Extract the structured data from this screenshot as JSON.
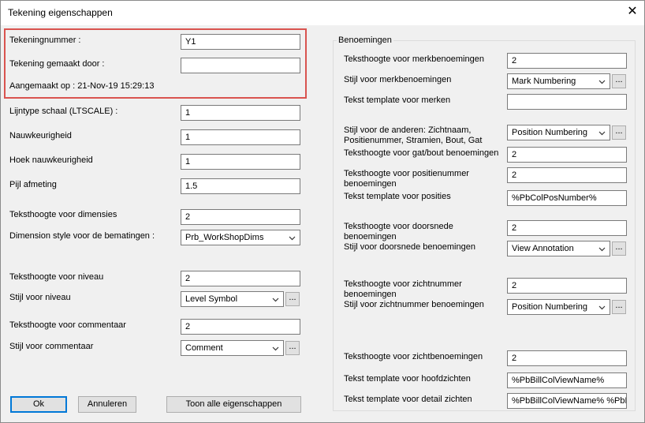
{
  "window": {
    "title": "Tekening eigenschappen",
    "close_glyph": "✕"
  },
  "left": {
    "drawing_number": {
      "label": "Tekeningnummer :",
      "value": "Y1"
    },
    "drawn_by": {
      "label": "Tekening gemaakt door :",
      "value": ""
    },
    "created": {
      "label": "Aangemaakt op :  21-Nov-19   15:29:13"
    },
    "ltscale": {
      "label": "Lijntype schaal (LTSCALE) :",
      "value": "1"
    },
    "precision": {
      "label": "Nauwkeurigheid",
      "value": "1"
    },
    "angle_precision": {
      "label": "Hoek nauwkeurigheid",
      "value": "1"
    },
    "arrow_size": {
      "label": "Pijl afmeting",
      "value": "1.5"
    },
    "dim_text_height": {
      "label": "Teksthoogte voor dimensies",
      "value": "2"
    },
    "dim_style": {
      "label": "Dimension style voor de bematingen :",
      "value": "Prb_WorkShopDims"
    },
    "level_text_height": {
      "label": "Teksthoogte voor niveau",
      "value": "2"
    },
    "level_style": {
      "label": "Stijl voor niveau",
      "value": "Level Symbol"
    },
    "comment_text_height": {
      "label": "Teksthoogte voor commentaar",
      "value": "2"
    },
    "comment_style": {
      "label": "Stijl voor commentaar",
      "value": "Comment"
    }
  },
  "right": {
    "group_title": "Benoemingen",
    "mark_text_height": {
      "label": "Teksthoogte voor merkbenoemingen",
      "value": "2"
    },
    "mark_style": {
      "label": "Stijl voor merkbenoemingen",
      "value": "Mark Numbering"
    },
    "mark_template": {
      "label": "Tekst template voor merken",
      "value": ""
    },
    "other_style": {
      "label1": "Stijl voor de anderen: Zichtnaam,",
      "label2": "Positienummer, Stramien, Bout, Gat",
      "value": "Position Numbering"
    },
    "hole_bolt_text_height": {
      "label": "Teksthoogte voor gat/bout benoemingen",
      "value": "2"
    },
    "posnum_text_height": {
      "label1": "Teksthoogte voor positienummer",
      "label2": "benoemingen",
      "value": "2"
    },
    "position_template": {
      "label": "Tekst template voor posities",
      "value": "%PbColPosNumber%"
    },
    "section_text_height": {
      "label1": "Teksthoogte voor doorsnede",
      "label2": "benoemingen",
      "value": "2"
    },
    "section_style": {
      "label": "Stijl voor doorsnede benoemingen",
      "value": "View Annotation"
    },
    "viewnum_text_height": {
      "label1": "Teksthoogte voor zichtnummer",
      "label2": "benoemingen",
      "value": "2"
    },
    "viewnum_style": {
      "label": "Stijl voor zichtnummer benoemingen",
      "value": "Position Numbering"
    },
    "view_text_height": {
      "label": "Teksthoogte voor zichtbenoemingen",
      "value": "2"
    },
    "main_view_template": {
      "label": "Tekst template voor hoofdzichten",
      "value": "%PbBillColViewName%"
    },
    "detail_view_template": {
      "label": "Tekst template voor detail zichten",
      "value": "%PbBillColViewName% %PbBi"
    }
  },
  "buttons": {
    "ok": "Ok",
    "cancel": "Annuleren",
    "show_all": "Toon alle eigenschappen",
    "browse": "..."
  }
}
